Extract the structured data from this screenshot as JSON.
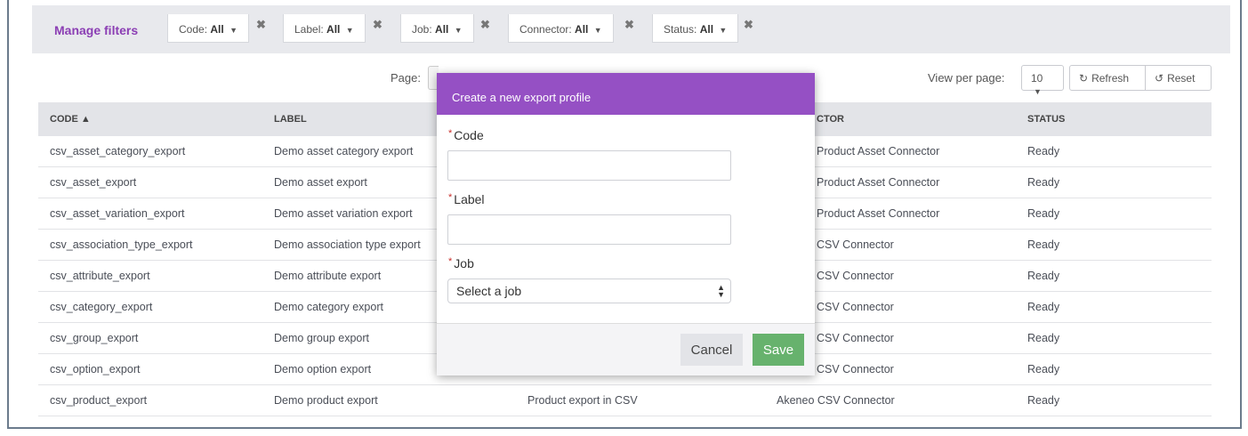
{
  "filters": {
    "manage": "Manage filters",
    "chips": [
      {
        "name": "Code:",
        "value": "All"
      },
      {
        "name": "Label:",
        "value": "All"
      },
      {
        "name": "Job:",
        "value": "All"
      },
      {
        "name": "Connector:",
        "value": "All"
      },
      {
        "name": "Status:",
        "value": "All"
      }
    ],
    "remove_glyph": "✖",
    "caret": "▼"
  },
  "toolbar": {
    "page_label": "Page:",
    "view_per_page_label": "View per page:",
    "view_per_page_value": "10",
    "refresh_label": "Refresh",
    "reset_label": "Reset"
  },
  "table": {
    "headers": [
      "CODE ▲",
      "LABEL",
      "CTOR",
      "STATUS"
    ],
    "rows": [
      {
        "code": "csv_asset_category_export",
        "label": "Demo asset category export",
        "job": "",
        "connector": "Product Asset Connector",
        "status": "Ready"
      },
      {
        "code": "csv_asset_export",
        "label": "Demo asset export",
        "job": "",
        "connector": "Product Asset Connector",
        "status": "Ready"
      },
      {
        "code": "csv_asset_variation_export",
        "label": "Demo asset variation export",
        "job": "",
        "connector": "Product Asset Connector",
        "status": "Ready"
      },
      {
        "code": "csv_association_type_export",
        "label": "Demo association type export",
        "job": "",
        "connector": "CSV Connector",
        "status": "Ready"
      },
      {
        "code": "csv_attribute_export",
        "label": "Demo attribute export",
        "job": "",
        "connector": "CSV Connector",
        "status": "Ready"
      },
      {
        "code": "csv_category_export",
        "label": "Demo category export",
        "job": "",
        "connector": "CSV Connector",
        "status": "Ready"
      },
      {
        "code": "csv_group_export",
        "label": "Demo group export",
        "job": "",
        "connector": "CSV Connector",
        "status": "Ready"
      },
      {
        "code": "csv_option_export",
        "label": "Demo option export",
        "job": "",
        "connector": "CSV Connector",
        "status": "Ready"
      },
      {
        "code": "csv_product_export",
        "label": "Demo product export",
        "job": "Product export in CSV",
        "connector": "Akeneo CSV Connector",
        "status": "Ready"
      }
    ]
  },
  "modal": {
    "title": "Create a new export profile",
    "required_mark": "*",
    "code_label": "Code",
    "label_label": "Label",
    "job_label": "Job",
    "job_select_value": "Select a job",
    "cancel_label": "Cancel",
    "save_label": "Save"
  },
  "colors": {
    "accent": "#9550c4",
    "save": "#67b26d"
  }
}
